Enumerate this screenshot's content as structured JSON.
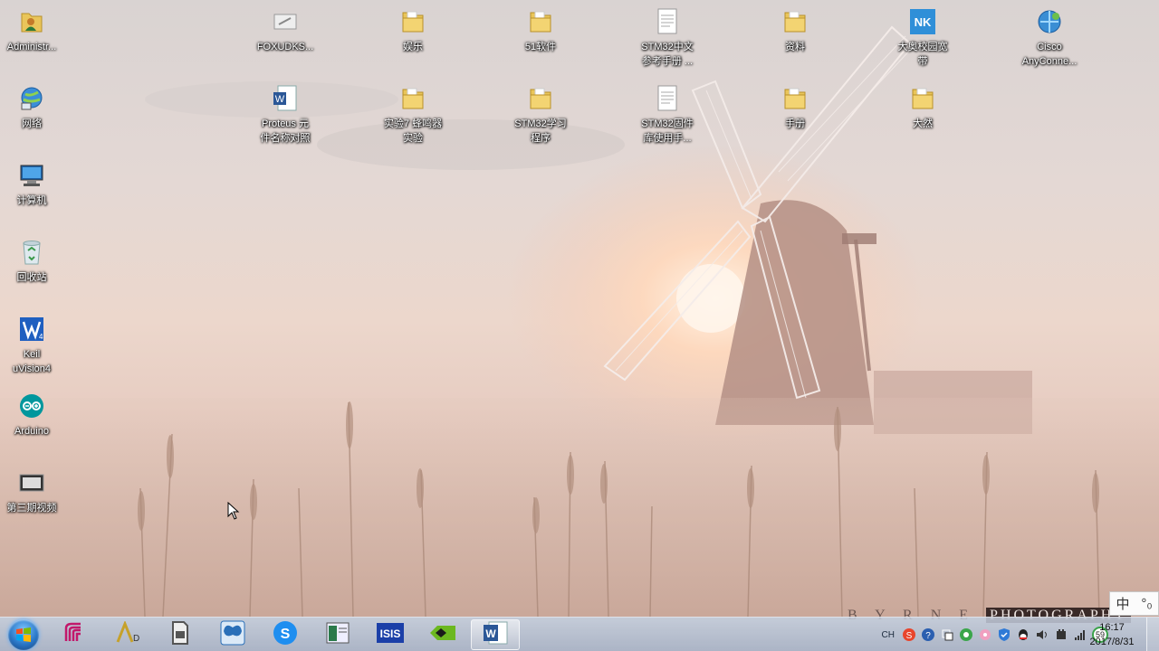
{
  "desktop": {
    "icons": [
      {
        "label": "Administr...",
        "icon": "user-folder-icon"
      },
      {
        "label": "网络",
        "icon": "network-icon"
      },
      {
        "label": "计算机",
        "icon": "computer-icon"
      },
      {
        "label": "回收站",
        "icon": "recycle-bin-icon"
      },
      {
        "label": "Keil\nuVision4",
        "icon": "keil-icon"
      },
      {
        "label": "Arduino",
        "icon": "arduino-icon"
      },
      {
        "label": "第三期视频",
        "icon": "video-icon"
      },
      {
        "label": "FOXUDKS...",
        "icon": "file-icon"
      },
      {
        "label": "Proteus 元\n件名称对照",
        "icon": "word-doc-icon"
      },
      {
        "label": "娱乐",
        "icon": "folder-icon"
      },
      {
        "label": "实验7 蜂鸣器\n实验",
        "icon": "folder-icon"
      },
      {
        "label": "51软件",
        "icon": "folder-icon"
      },
      {
        "label": "STM32学习\n程序",
        "icon": "folder-icon"
      },
      {
        "label": "STM32中文\n参考手册 ...",
        "icon": "document-icon"
      },
      {
        "label": "STM32固件\n库使用手...",
        "icon": "document-icon"
      },
      {
        "label": "资料",
        "icon": "folder-icon"
      },
      {
        "label": "手册",
        "icon": "folder-icon"
      },
      {
        "label": "大奥校园宽\n带",
        "icon": "broadband-icon"
      },
      {
        "label": "大然",
        "icon": "folder-icon"
      },
      {
        "label": "Cisco\nAnyConne...",
        "icon": "cisco-icon"
      }
    ]
  },
  "watermark": {
    "left": "B Y R N E",
    "right": "PHOTOGRAPHY"
  },
  "ime": {
    "lang": "中",
    "mode": "°₀"
  },
  "taskbar": {
    "start_icon": "windows-start-icon",
    "pinned": [
      {
        "icon": "app-stripes-icon",
        "color": "#c2186b"
      },
      {
        "icon": "altium-icon",
        "color": "#c6a12a"
      },
      {
        "icon": "sd-card-tool-icon",
        "color": "#555555"
      },
      {
        "icon": "butterfly-app-icon",
        "color": "#2a6fb8"
      },
      {
        "icon": "sogou-browser-icon",
        "color": "#1e8ef0"
      },
      {
        "icon": "document-viewer-icon",
        "color": "#2b7a4b"
      },
      {
        "icon": "isis-proteus-icon",
        "color": "#1b3fa8"
      },
      {
        "icon": "nvidia-icon",
        "color": "#6cb820"
      },
      {
        "icon": "word-icon",
        "color": "#2b5797"
      }
    ],
    "tray": {
      "lang": "CH",
      "icons": [
        "sogou-ime-icon",
        "help-icon",
        "notification-icon",
        "360-icon",
        "flower-icon",
        "shield-icon",
        "qq-icon",
        "volume-icon",
        "power-icon",
        "signal-icon"
      ],
      "badge": "59"
    },
    "clock": {
      "time": "16:17",
      "date": "2017/8/31"
    }
  }
}
